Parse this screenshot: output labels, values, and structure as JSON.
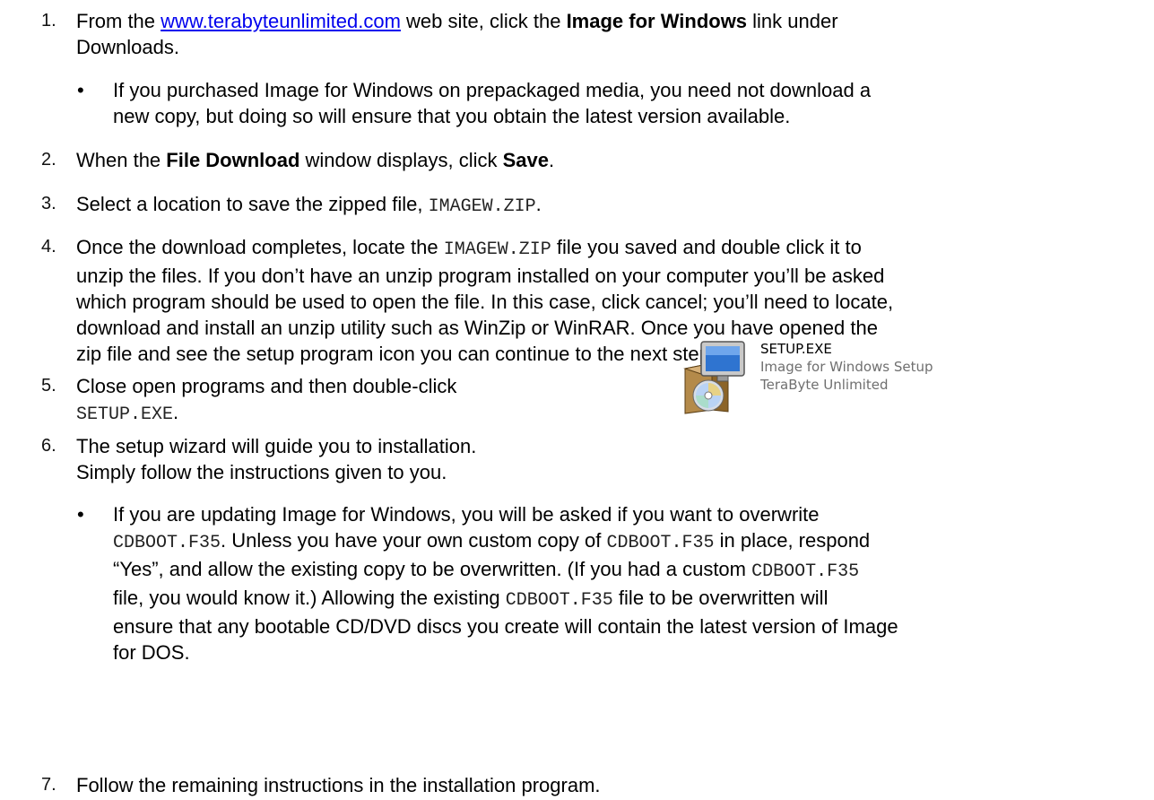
{
  "steps": [
    {
      "number": "1.",
      "pre": "From the ",
      "link": "www.terabyteunlimited.com",
      "mid": " web site, click the ",
      "bold": "Image for Windows",
      "post": " link under",
      "line2": "Downloads."
    },
    {
      "number": "2.",
      "pre": "When the ",
      "bold1": "File Download",
      "mid": " window displays, click ",
      "bold2": "Save",
      "post": "."
    },
    {
      "number": "3.",
      "pre": "Select a location to save the zipped file, ",
      "code": "IMAGEW.ZIP",
      "post": "."
    },
    {
      "number": "4.",
      "pre": "Once the download completes, locate the ",
      "code": "IMAGEW.ZIP",
      "post": " file you saved and double click it to",
      "line2": "unzip the files.  If you don’t have an unzip program installed on your computer you’ll be asked",
      "line3": "which program should be used to open the file.  In this case, click cancel; you’ll need to locate,",
      "line4": "download and install an unzip utility such as WinZip or WinRAR.  Once you have opened the",
      "line5": "zip file and see the setup program icon you can continue to the next step."
    },
    {
      "number": "5.",
      "line1": "Close open programs and then double-click",
      "code": "SETUP.EXE",
      "post": "."
    },
    {
      "number": "6.",
      "line1": "The setup wizard will guide you to installation.",
      "line2": "Simply follow the instructions given to you."
    },
    {
      "number": "7.",
      "line1": "Follow the remaining instructions in the installation program."
    }
  ],
  "bullets": {
    "bullet1": {
      "symbol": "•",
      "line1": "If you purchased Image for Windows on prepackaged media, you need not download a",
      "line2": "new copy, but doing so will ensure that you obtain the latest version available."
    },
    "bullet2": {
      "symbol": "•",
      "l1a": "If you are updating Image for Windows, you will be asked if you want to overwrite",
      "l2code1": "CDBOOT.F35",
      "l2a": ".  Unless you have your own custom copy of ",
      "l2code2": "CDBOOT.F35",
      "l2b": " in place, respond",
      "l3a": "“Yes”, and allow the existing copy to be overwritten.  (If you had a custom ",
      "l3code": "CDBOOT.F35",
      "l4a": "file, you would know it.)  Allowing the existing ",
      "l4code": "CDBOOT.F35",
      "l4b": " file to be overwritten will",
      "l5": "ensure that any bootable CD/DVD discs you create will contain the latest version of Image",
      "l6": "for DOS."
    }
  },
  "setup_file": {
    "icon": "setup-installer-icon",
    "filename": "SETUP.EXE",
    "description": "Image for Windows Setup",
    "company": "TeraByte Unlimited"
  }
}
